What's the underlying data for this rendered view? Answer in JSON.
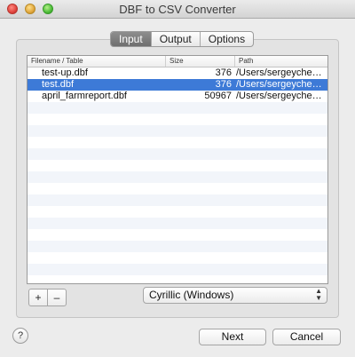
{
  "window": {
    "title": "DBF to CSV Converter"
  },
  "tabs": [
    {
      "label": "Input",
      "active": true
    },
    {
      "label": "Output",
      "active": false
    },
    {
      "label": "Options",
      "active": false
    }
  ],
  "table": {
    "columns": [
      "Filename / Table",
      "Size",
      "Path"
    ],
    "rows": [
      {
        "filename": "test-up.dbf",
        "size": "376",
        "path": "/Users/sergeyche…",
        "selected": false
      },
      {
        "filename": "test.dbf",
        "size": "376",
        "path": "/Users/sergeyche…",
        "selected": true
      },
      {
        "filename": "april_farmreport.dbf",
        "size": "50967",
        "path": "/Users/sergeyche…",
        "selected": false
      }
    ]
  },
  "controls": {
    "add_label": "+",
    "remove_label": "–",
    "encoding": "Cyrillic (Windows)",
    "help_label": "?",
    "next_label": "Next",
    "cancel_label": "Cancel"
  },
  "colors": {
    "selection": "#3d7ad7",
    "stripe": "#f2f5fa"
  }
}
